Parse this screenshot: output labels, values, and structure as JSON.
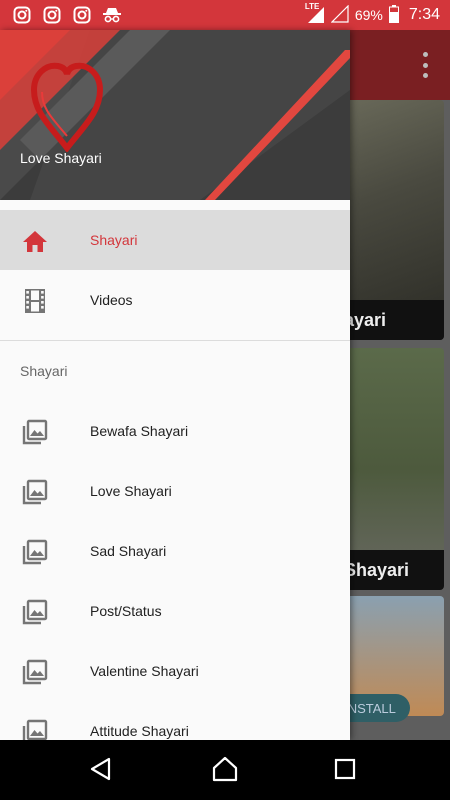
{
  "status_bar": {
    "left_icons": [
      "instagram-icon",
      "instagram-icon",
      "instagram-icon",
      "incognito-icon"
    ],
    "network": "LTE",
    "battery": "69%",
    "time": "7:34"
  },
  "background": {
    "card_captions": [
      "ayari",
      "Shayari"
    ],
    "install_label": "INSTALL"
  },
  "drawer": {
    "header_title": "Love Shayari",
    "primary_items": [
      {
        "label": "Shayari",
        "icon": "home-icon",
        "active": true
      },
      {
        "label": "Videos",
        "icon": "film-icon",
        "active": false
      }
    ],
    "section_title": "Shayari",
    "section_items": [
      {
        "label": "Bewafa Shayari",
        "icon": "image-library-icon"
      },
      {
        "label": "Love Shayari",
        "icon": "image-library-icon"
      },
      {
        "label": "Sad Shayari",
        "icon": "image-library-icon"
      },
      {
        "label": "Post/Status",
        "icon": "image-library-icon"
      },
      {
        "label": "Valentine Shayari",
        "icon": "image-library-icon"
      },
      {
        "label": "Attitude Shayari",
        "icon": "image-library-icon"
      }
    ]
  },
  "colors": {
    "accent": "#d3363b",
    "active_bg": "#dcdcdc",
    "header_bg": "#3b3b3b"
  }
}
